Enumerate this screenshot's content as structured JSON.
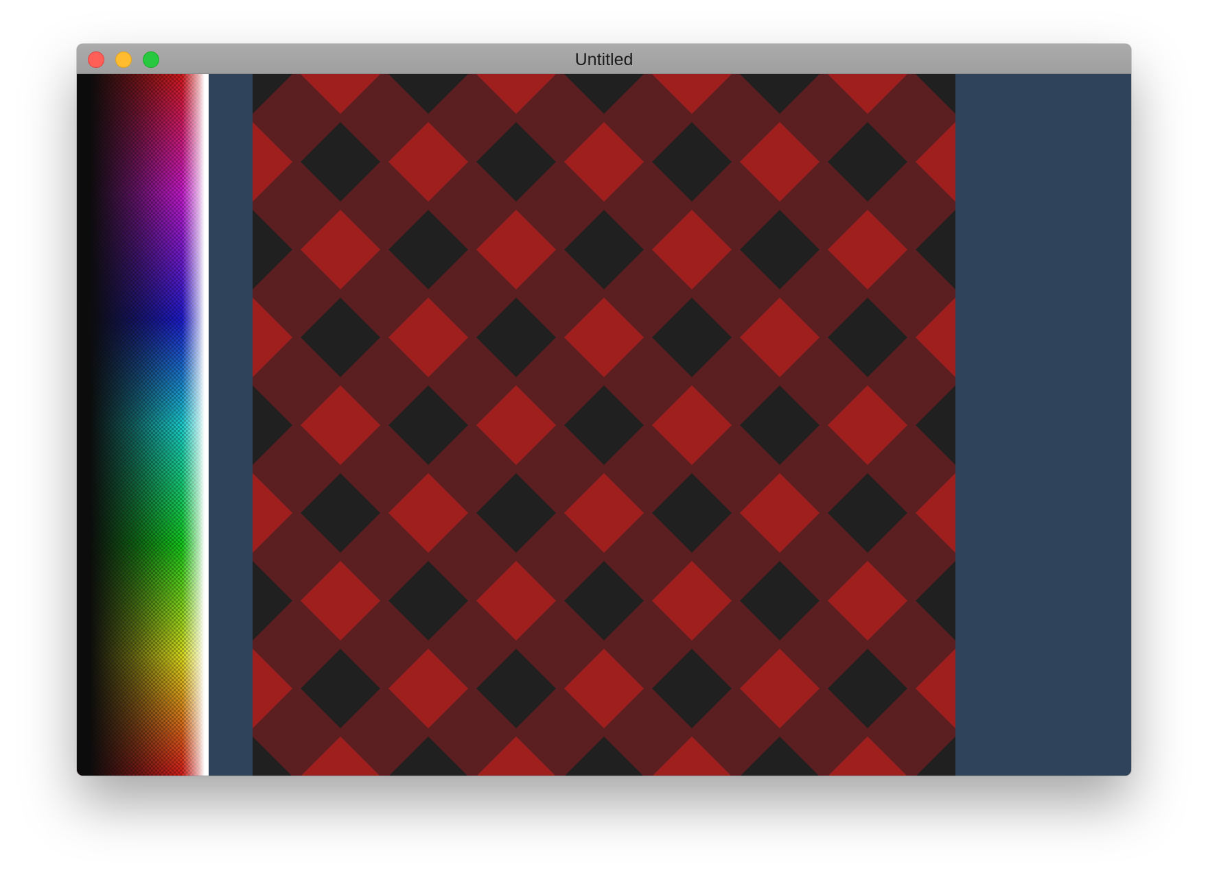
{
  "window": {
    "title": "Untitled"
  },
  "colors": {
    "background": "#2f445a",
    "tile_red": "#9f1f1f",
    "tile_dark_red": "#5c1f21",
    "tile_black": "#202020"
  },
  "icons": {
    "close": "close-traffic-light",
    "minimize": "minimize-traffic-light",
    "maximize": "maximize-traffic-light"
  }
}
